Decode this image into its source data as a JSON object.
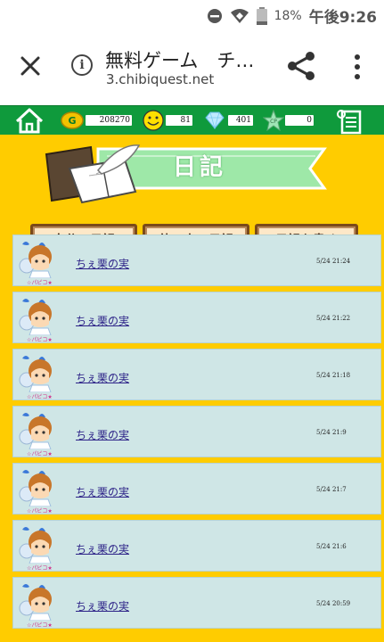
{
  "status": {
    "battery": "18%",
    "time": "午後9:26"
  },
  "browser": {
    "title": "無料ゲーム　チ…",
    "host": "3.chibiquest.net"
  },
  "topbar": {
    "gold": "208270",
    "smile": "81",
    "diamond": "401",
    "cp": "0",
    "cp_label": "CP",
    "gold_label": "G"
  },
  "page": {
    "title": "日記",
    "tabs": [
      "自分の日記",
      "他の人の日記",
      "日記を書く"
    ]
  },
  "entries": [
    {
      "user": "☆パピコ★",
      "title": "ちぇ栗の実",
      "time": "5/24 21:24"
    },
    {
      "user": "☆パピコ★",
      "title": "ちぇ栗の実",
      "time": "5/24 21:22"
    },
    {
      "user": "☆パピコ★",
      "title": "ちぇ栗の実",
      "time": "5/24 21:18"
    },
    {
      "user": "☆パピコ★",
      "title": "ちぇ栗の実",
      "time": "5/24 21:9"
    },
    {
      "user": "☆パピコ★",
      "title": "ちぇ栗の実",
      "time": "5/24 21:7"
    },
    {
      "user": "☆パピコ★",
      "title": "ちぇ栗の実",
      "time": "5/24 21:6"
    },
    {
      "user": "☆パピコ★",
      "title": "ちぇ栗の実",
      "time": "5/24 20:59"
    }
  ],
  "colors": {
    "game_bg": "#ffcc00",
    "topbar": "#0f9a3c",
    "entry_bg": "#cfe6e6",
    "link": "#2a1f86"
  }
}
